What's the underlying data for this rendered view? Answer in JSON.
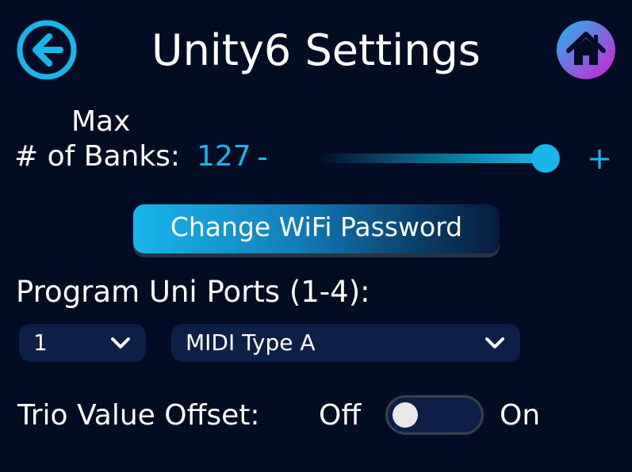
{
  "header": {
    "title": "Unity6 Settings",
    "back_icon": "back-arrow-icon",
    "home_icon": "home-icon"
  },
  "banks": {
    "label_line1": "Max",
    "label_line2": "# of Banks:",
    "value": "127",
    "minus_label": "-",
    "plus_label": "+",
    "slider_fraction": 0.9
  },
  "wifi": {
    "button_label": "Change WiFi Password"
  },
  "ports": {
    "label": "Program Uni Ports (1-4):",
    "port_selected": "1",
    "type_selected": "MIDI Type A"
  },
  "trio": {
    "label": "Trio Value Offset:",
    "off_label": "Off",
    "on_label": "On",
    "state": "off"
  },
  "colors": {
    "background": "#020d24",
    "accent": "#19b6ec",
    "control_bg": "#0c2046",
    "home_gradient_start": "#1fb8ee",
    "home_gradient_end": "#d21fd0"
  }
}
